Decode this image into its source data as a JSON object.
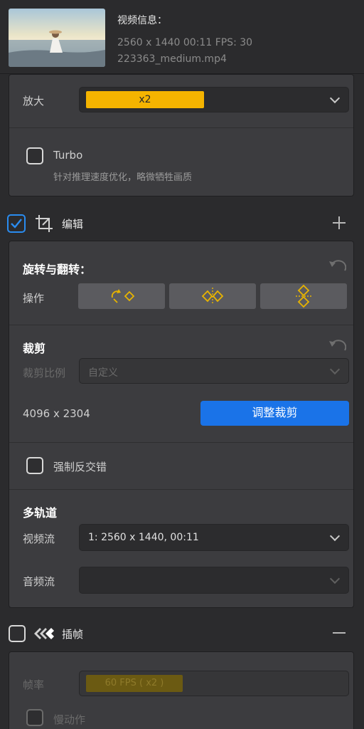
{
  "header": {
    "title": "视频信息：",
    "specs": "2560 x 1440  00:11    FPS: 30",
    "filename": "223363_medium.mp4"
  },
  "upscale": {
    "label": "放大",
    "value": "x2",
    "accent": "#f5b400"
  },
  "turbo": {
    "label": "Turbo",
    "description": "针对推理速度优化，略微牺牲画质",
    "checked": false
  },
  "edit_section": {
    "title": "编辑",
    "checked": true,
    "icon": "crop-icon",
    "action_icon": "plus-icon"
  },
  "rotate_flip": {
    "heading": "旋转与翻转：",
    "ops_label": "操作",
    "buttons": [
      "rotate-icon",
      "flip-horizontal-icon",
      "flip-vertical-icon"
    ],
    "icon_color": "#e8b400"
  },
  "crop": {
    "heading": "裁剪",
    "ratio_label": "裁剪比例",
    "ratio_value": "自定义",
    "dimensions": "4096 x 2304",
    "adjust_button": "调整裁剪",
    "button_color": "#1a73e8"
  },
  "deinterlace": {
    "label": "强制反交错",
    "checked": false
  },
  "multitrack": {
    "heading": "多轨道",
    "video_label": "视频流",
    "video_value": "1: 2560 x 1440,  00:11",
    "audio_label": "音频流",
    "audio_value": ""
  },
  "interpolation": {
    "title": "插帧",
    "checked": false,
    "icon": "frames-icon",
    "action_icon": "minus-icon",
    "fps_label": "帧率",
    "fps_value": "60 FPS ( x2 )",
    "slowmo_label": "慢动作"
  }
}
